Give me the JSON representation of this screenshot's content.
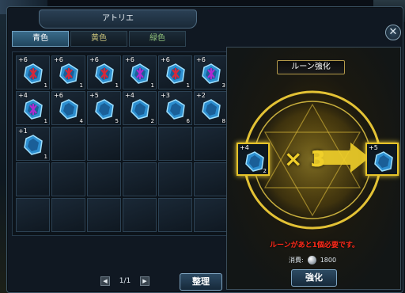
{
  "window": {
    "title": "アトリエ"
  },
  "tabs": [
    {
      "label": "青色",
      "active": true
    },
    {
      "label": "黄色",
      "active": false
    },
    {
      "label": "緑色",
      "active": false
    }
  ],
  "inventory": [
    {
      "plus": "+6",
      "qty": "1",
      "glyph": "red"
    },
    {
      "plus": "+6",
      "qty": "1",
      "glyph": "red"
    },
    {
      "plus": "+6",
      "qty": "1",
      "glyph": "red"
    },
    {
      "plus": "+6",
      "qty": "1",
      "glyph": "purple"
    },
    {
      "plus": "+6",
      "qty": "1",
      "glyph": "red"
    },
    {
      "plus": "+6",
      "qty": "3",
      "glyph": "purple"
    },
    {
      "plus": "+4",
      "qty": "1",
      "glyph": "purple"
    },
    {
      "plus": "+6",
      "qty": "4",
      "glyph": "none"
    },
    {
      "plus": "+5",
      "qty": "5",
      "glyph": "none"
    },
    {
      "plus": "+4",
      "qty": "2",
      "glyph": "none"
    },
    {
      "plus": "+3",
      "qty": "6",
      "glyph": "none"
    },
    {
      "plus": "+2",
      "qty": "8",
      "glyph": "none"
    },
    {
      "plus": "+1",
      "qty": "1",
      "glyph": "none"
    }
  ],
  "pager": {
    "text": "1/1"
  },
  "buttons": {
    "sort": "整理",
    "enhance": "強化",
    "close": "✕"
  },
  "enhance": {
    "title": "ルーン強化",
    "source": {
      "plus": "+4",
      "qty": "2"
    },
    "multiplier": "3",
    "result": {
      "plus": "+5"
    },
    "warning": "ルーンがあと1個必要です。",
    "cost_label": "消費:",
    "cost_value": "1800"
  },
  "colors": {
    "accent": "#f0cf2a",
    "warning": "#ff2a1a",
    "tab_active": "#3a6b8a"
  }
}
